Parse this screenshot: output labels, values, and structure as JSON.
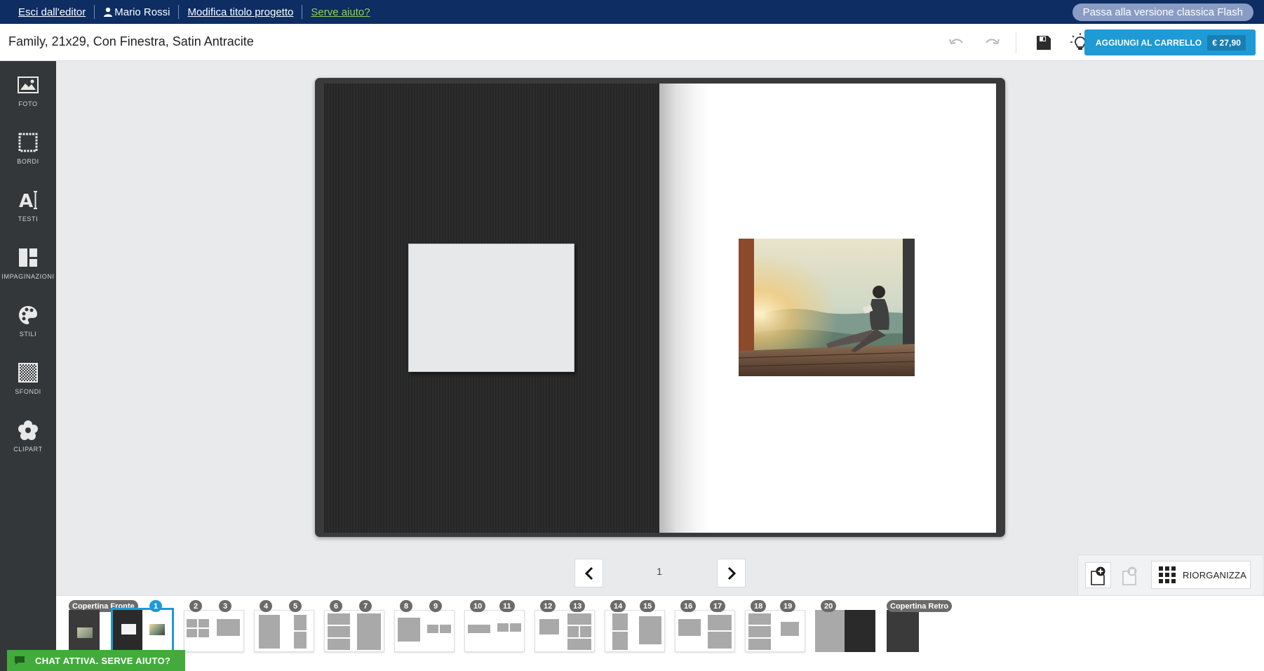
{
  "topbar": {
    "exit_label": "Esci dall'editor",
    "user_name": "Mario Rossi",
    "edit_title_label": "Modifica titolo progetto",
    "help_label": "Serve aiuto?",
    "flash_label": "Passa alla versione classica Flash"
  },
  "header": {
    "project_title": "Family, 21x29, Con Finestra, Satin Antracite",
    "cart_label": "AGGIUNGI AL CARRELLO",
    "cart_price": "€ 27,90"
  },
  "sidebar": {
    "items": [
      {
        "label": "FOTO",
        "icon": "photo-icon"
      },
      {
        "label": "BORDI",
        "icon": "border-icon"
      },
      {
        "label": "TESTI",
        "icon": "text-icon"
      },
      {
        "label": "IMPAGINAZIONI",
        "icon": "layout-icon"
      },
      {
        "label": "STILI",
        "icon": "palette-icon"
      },
      {
        "label": "SFONDI",
        "icon": "background-icon"
      },
      {
        "label": "CLIPART",
        "icon": "flower-icon"
      }
    ]
  },
  "pager": {
    "current_page": "1"
  },
  "tools": {
    "reorganize_label": "RIORGANIZZA"
  },
  "thumbnails": {
    "cover_front_label": "Copertina Fronte",
    "cover_back_label": "Copertina Retro",
    "page_numbers": [
      "1",
      "2",
      "3",
      "4",
      "5",
      "6",
      "7",
      "8",
      "9",
      "10",
      "11",
      "12",
      "13",
      "14",
      "15",
      "16",
      "17",
      "18",
      "19",
      "20"
    ]
  },
  "chat": {
    "label": "CHAT ATTIVA. SERVE AIUTO?"
  },
  "colors": {
    "topbar": "#0d2d63",
    "accent": "#1e9ad6",
    "help_link": "#8fd34f",
    "chat": "#43ab3c",
    "sidebar": "#33373a"
  }
}
